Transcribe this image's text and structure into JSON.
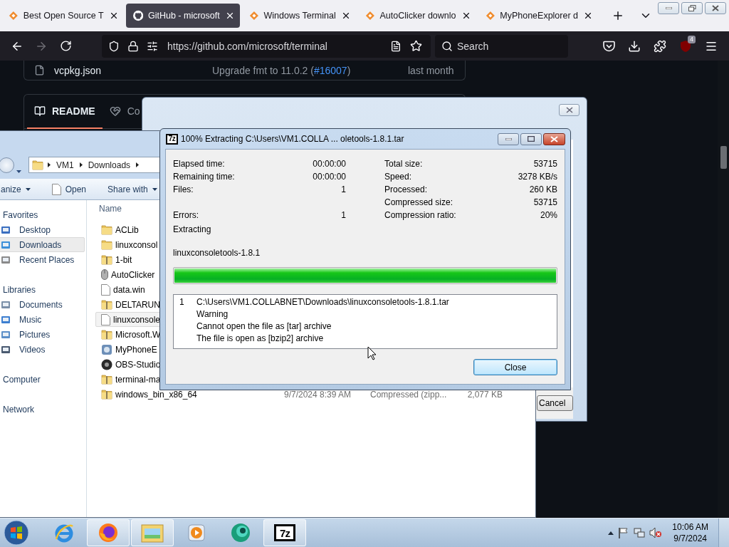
{
  "browser": {
    "tabs": [
      {
        "title": "Best Open Source T",
        "kind": "site",
        "selected": false
      },
      {
        "title": "GitHub - microsoft",
        "kind": "github",
        "selected": true
      },
      {
        "title": "Windows Terminal",
        "kind": "site",
        "selected": false
      },
      {
        "title": "AutoClicker downlo",
        "kind": "site",
        "selected": false
      },
      {
        "title": "MyPhoneExplorer d",
        "kind": "site",
        "selected": false
      }
    ],
    "forward_disabled": true,
    "url": "https://github.com/microsoft/terminal",
    "search": {
      "placeholder": "Search"
    },
    "extension_badge": "4"
  },
  "github": {
    "file_row": {
      "name": "vcpkg.json",
      "message": "Upgrade fmt to 11.0.2 (",
      "issue": "#16007",
      "message_end": ")",
      "time": "last month"
    },
    "readme_tabs": [
      {
        "label": "README",
        "kind": "book",
        "selected": true
      },
      {
        "label": "Co",
        "kind": "heart",
        "selected": false
      }
    ]
  },
  "extract_dialog": {
    "cancel": "Cancel"
  },
  "explorer": {
    "breadcrumb": [
      "VM1",
      "Downloads"
    ],
    "toolbar": [
      {
        "label": "anize",
        "kind": "menu"
      },
      {
        "label": "Open",
        "kind": "open"
      },
      {
        "label": "Share with",
        "kind": "menu"
      }
    ],
    "nav_pane": [
      {
        "label": "Favorites",
        "selected": false,
        "children": [
          {
            "label": "Desktop",
            "kind": "desktop",
            "selected": false
          },
          {
            "label": "Downloads",
            "kind": "downloads",
            "selected": true
          },
          {
            "label": "Recent Places",
            "kind": "recent",
            "selected": false
          }
        ]
      },
      {
        "label": "Libraries",
        "selected": false,
        "children": [
          {
            "label": "Documents",
            "kind": "documents",
            "selected": false
          },
          {
            "label": "Music",
            "kind": "music",
            "selected": false
          },
          {
            "label": "Pictures",
            "kind": "pictures",
            "selected": false
          },
          {
            "label": "Videos",
            "kind": "videos",
            "selected": false
          }
        ]
      },
      {
        "label": "Computer",
        "selected": false
      },
      {
        "label": "Network",
        "selected": false
      }
    ],
    "columns": [
      "Name"
    ],
    "files": [
      {
        "name": "ACLib",
        "kind": "folder",
        "selected": false
      },
      {
        "name": "linuxconsol",
        "kind": "folder",
        "selected": false
      },
      {
        "name": "1-bit",
        "kind": "zip",
        "selected": false
      },
      {
        "name": "AutoClicker",
        "kind": "mouse",
        "selected": false
      },
      {
        "name": "data.win",
        "kind": "file",
        "selected": false
      },
      {
        "name": "DELTARUN",
        "kind": "zip",
        "selected": false
      },
      {
        "name": "linuxconsole",
        "kind": "file",
        "selected": true
      },
      {
        "name": "Microsoft.W",
        "kind": "zip",
        "selected": false
      },
      {
        "name": "MyPhoneE",
        "kind": "app",
        "selected": false
      },
      {
        "name": "OBS-Studio",
        "kind": "disc",
        "selected": false
      },
      {
        "name": "terminal-ma",
        "kind": "zip",
        "selected": false
      },
      {
        "name": "windows_bin_x86_64",
        "kind": "zip",
        "selected": false,
        "date": "9/7/2024 8:39 AM",
        "type": "Compressed (zipp...",
        "size": "2,077 KB"
      }
    ]
  },
  "sevenzip": {
    "icon": "7z",
    "title": "100% Extracting C:\\Users\\VM1.COLLA ... oletools-1.8.1.tar",
    "stats": [
      {
        "left": {
          "label": "Elapsed time:",
          "value": "00:00:00"
        },
        "right": {
          "label": "Total size:",
          "value": "53715"
        }
      },
      {
        "left": {
          "label": "Remaining time:",
          "value": "00:00:00"
        },
        "right": {
          "label": "Speed:",
          "value": "3278 KB/s"
        }
      },
      {
        "left": {
          "label": "Files:",
          "value": "1"
        },
        "right": {
          "label": "Processed:",
          "value": "260 KB"
        }
      },
      {
        "right": {
          "label": "Compressed size:",
          "value": "53715"
        }
      },
      {
        "left": {
          "label": "Errors:",
          "value": "1"
        },
        "right": {
          "label": "Compression ratio:",
          "value": "20%"
        }
      }
    ],
    "status": "Extracting",
    "current_file": "linuxconsoletools-1.8.1",
    "level": 1,
    "messages": [
      {
        "number": "1",
        "lines": [
          "C:\\Users\\VM1.COLLABNET\\Downloads\\linuxconsoletools-1.8.1.tar",
          "Warning",
          "Cannot open the file as [tar] archive",
          "The file is open as [bzip2] archive"
        ]
      }
    ],
    "close": "Close"
  },
  "taskbar": {
    "apps": [
      {
        "kind": "ie",
        "active": false
      },
      {
        "kind": "firefox",
        "active": true
      },
      {
        "kind": "explorer",
        "active": true
      },
      {
        "kind": "media",
        "active": false
      },
      {
        "kind": "green",
        "active": false
      },
      {
        "kind": "sevenzip",
        "label": "7z",
        "active": true
      }
    ],
    "clock": {
      "time": "10:06 AM",
      "date": "9/7/2024"
    }
  }
}
